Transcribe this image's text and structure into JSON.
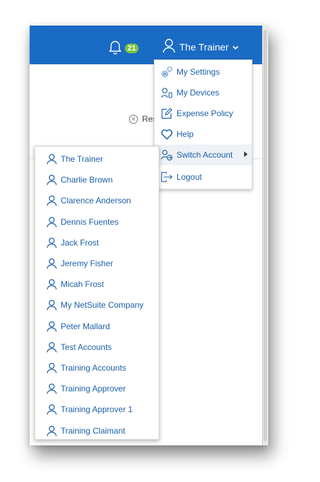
{
  "header": {
    "notification_count": "21",
    "user_name": "The Trainer"
  },
  "background": {
    "partial_text": "Res"
  },
  "user_menu": {
    "items": [
      {
        "label": "My Settings",
        "icon": "gear-icon"
      },
      {
        "label": "My Devices",
        "icon": "user-device-icon"
      },
      {
        "label": "Expense Policy",
        "icon": "edit-icon"
      },
      {
        "label": "Help",
        "icon": "heart-icon"
      },
      {
        "label": "Switch Account",
        "icon": "switch-account-icon"
      },
      {
        "label": "Logout",
        "icon": "logout-icon"
      }
    ]
  },
  "switch_account_menu": {
    "accounts": [
      "The Trainer",
      "Charlie Brown",
      "Clarence Anderson",
      "Dennis Fuentes",
      "Jack Frost",
      "Jeremy Fisher",
      "Micah Frost",
      "My NetSuite Company",
      "Peter Mallard",
      "Test Accounts",
      "Training Accounts",
      "Training Approver",
      "Training Approver 1",
      "Training Claimant"
    ]
  },
  "colors": {
    "header_bg": "#1a6bc4",
    "link": "#1b5fa7",
    "badge": "#7bc043"
  }
}
